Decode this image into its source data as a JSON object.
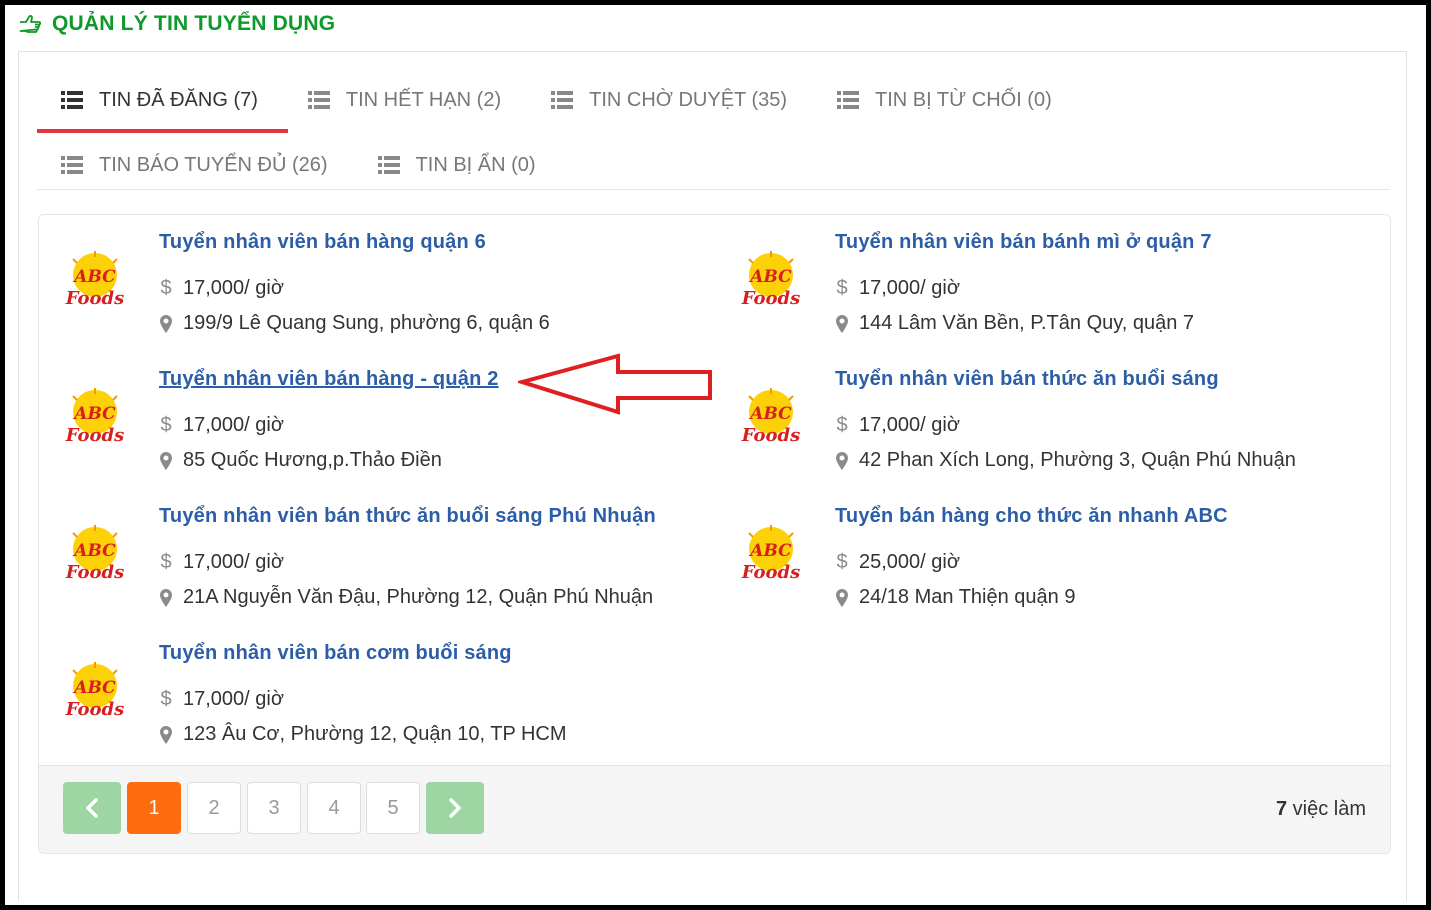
{
  "header": {
    "title": "QUẢN LÝ TIN TUYỂN DỤNG",
    "icon": "hand-pointer-icon",
    "title_color": "#0e9a2a"
  },
  "tabs": [
    {
      "label": "TIN ĐÃ ĐĂNG (7)",
      "active": true
    },
    {
      "label": "TIN HẾT HẠN (2)"
    },
    {
      "label": "TIN CHỜ DUYỆT (35)"
    },
    {
      "label": "TIN BỊ TỪ CHỐI (0)"
    },
    {
      "label": "TIN BÁO TUYỂN ĐỦ (26)"
    },
    {
      "label": "TIN BỊ ẨN (0)"
    }
  ],
  "logo_text": {
    "top": "ABC",
    "bottom": "Foods"
  },
  "jobs": [
    {
      "title": "Tuyển nhân viên bán hàng quận 6",
      "salary": "17,000/ giờ",
      "address": "199/9 Lê Quang Sung, phường 6, quận 6"
    },
    {
      "title": "Tuyển nhân viên bán bánh mì ở quận 7",
      "salary": "17,000/ giờ",
      "address": "144 Lâm Văn Bền, P.Tân Quy, quận 7"
    },
    {
      "title": "Tuyển nhân viên bán hàng - quận 2",
      "salary": "17,000/ giờ",
      "address": "85 Quốc Hương,p.Thảo Điền",
      "hovered": true
    },
    {
      "title": "Tuyển nhân viên bán thức ăn buổi sáng",
      "salary": "17,000/ giờ",
      "address": "42 Phan Xích Long, Phường 3, Quận Phú Nhuận"
    },
    {
      "title": "Tuyển nhân viên bán thức ăn buổi sáng Phú Nhuận",
      "salary": "17,000/ giờ",
      "address": "21A Nguyễn Văn Đậu, Phường 12, Quận Phú Nhuận"
    },
    {
      "title": "Tuyển bán hàng cho thức ăn nhanh ABC",
      "salary": "25,000/ giờ",
      "address": "24/18 Man Thiện quận 9"
    },
    {
      "title": "Tuyển nhân viên bán cơm buổi sáng",
      "salary": "17,000/ giờ",
      "address": "123 Âu Cơ, Phường 12, Quận 10, TP HCM"
    }
  ],
  "pagination": {
    "pages": [
      "1",
      "2",
      "3",
      "4",
      "5"
    ],
    "current": "1",
    "prev_icon": "chevron-left-icon",
    "next_icon": "chevron-right-icon"
  },
  "summary": {
    "count": "7",
    "label": " việc làm"
  },
  "colors": {
    "accent_red": "#e2363c",
    "link_blue": "#2b5ea7",
    "page_active": "#ff6b0f",
    "page_arrow": "#9dd6a3"
  }
}
